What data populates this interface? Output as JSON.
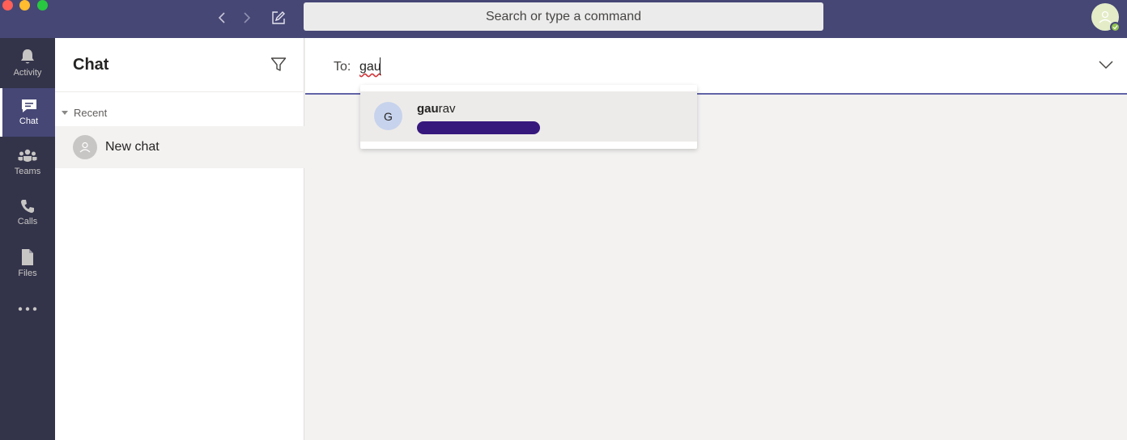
{
  "titlebar": {
    "search_placeholder": "Search or type a command"
  },
  "rail": {
    "items": [
      {
        "label": "Activity",
        "icon": "bell-icon"
      },
      {
        "label": "Chat",
        "icon": "chat-icon",
        "active": true
      },
      {
        "label": "Teams",
        "icon": "teams-icon"
      },
      {
        "label": "Calls",
        "icon": "phone-icon"
      },
      {
        "label": "Files",
        "icon": "file-icon"
      }
    ],
    "more_icon": "more-icon"
  },
  "panel": {
    "title": "Chat",
    "section": "Recent",
    "new_chat_label": "New chat"
  },
  "main": {
    "to_label": "To:",
    "to_value": "gau"
  },
  "suggestion": {
    "initial": "G",
    "name_match": "gau",
    "name_rest": "rav"
  },
  "colors": {
    "titlebar": "#464775",
    "rail": "#33344a",
    "accent": "#6264a7",
    "redaction": "#36187d"
  }
}
